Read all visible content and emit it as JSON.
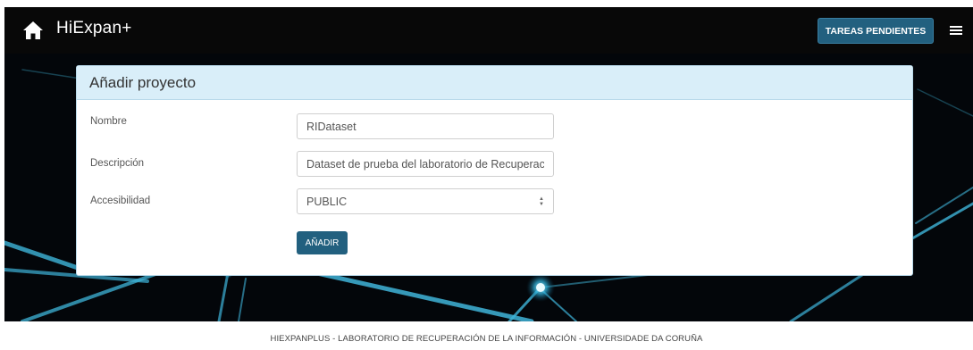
{
  "navbar": {
    "brand": "HiExpan+",
    "tareas_button": "TAREAS PENDIENTES",
    "home_icon": "home-icon",
    "menu_icon": "hamburger-menu-icon"
  },
  "card": {
    "title": "Añadir proyecto",
    "fields": {
      "nombre_label": "Nombre",
      "nombre_value": "RIDataset",
      "descripcion_label": "Descripción",
      "descripcion_value": "Dataset de prueba del laboratorio de Recuperació",
      "accesibilidad_label": "Accesibilidad",
      "accesibilidad_value": "PUBLIC"
    },
    "submit_label": "AÑADIR"
  },
  "footer": {
    "text": "HIEXPANPLUS - LABORATORIO DE RECUPERACIÓN DE LA INFORMACIÓN - UNIVERSIDADE DA CORUÑA"
  },
  "colors": {
    "navbar_bg": "#080808",
    "accent": "#22607f",
    "card_header_bg": "#d9eef9",
    "hero_bg": "#03060a"
  }
}
